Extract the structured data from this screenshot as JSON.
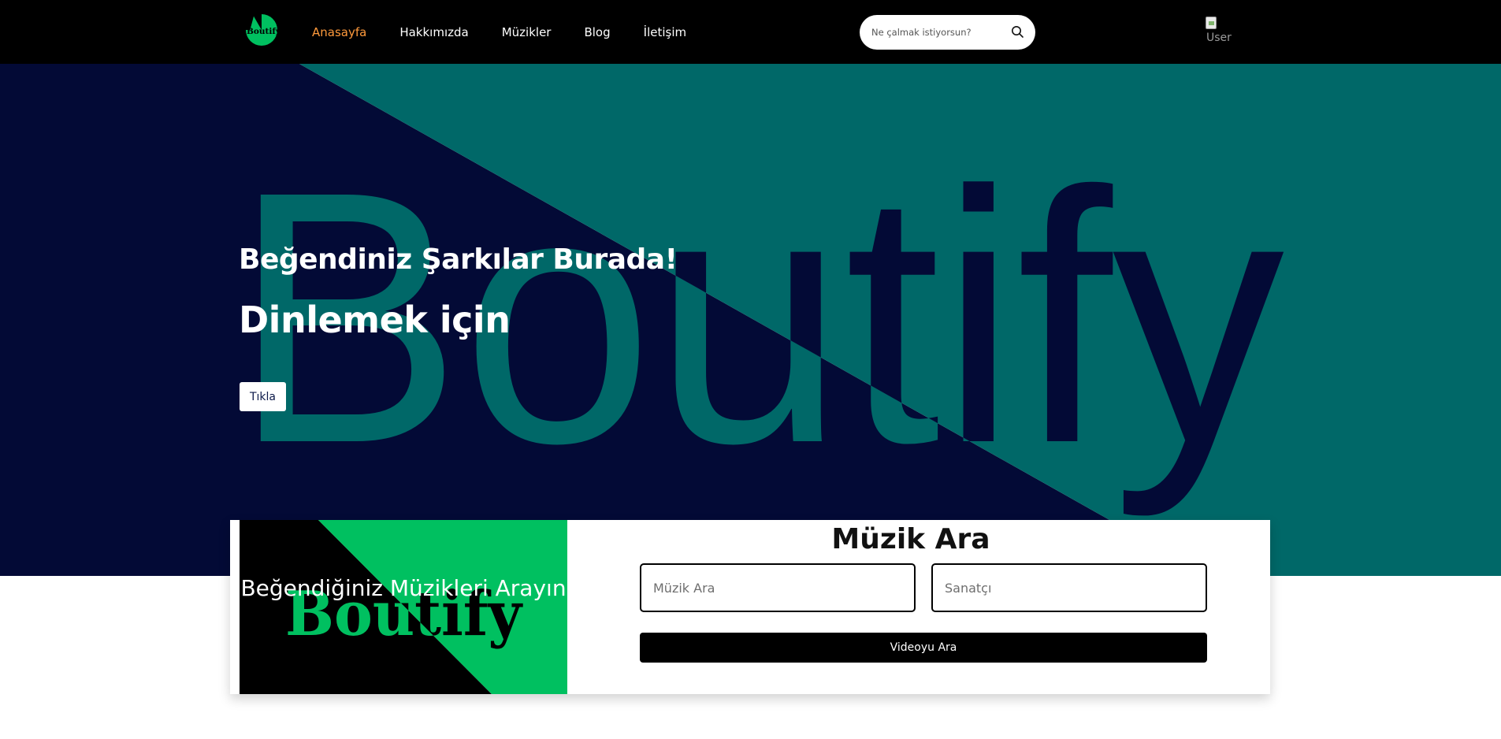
{
  "nav": {
    "logo_text": "Boutify",
    "links": [
      "Anasayfa",
      "Hakkımızda",
      "Müzikler",
      "Blog",
      "İletişim"
    ],
    "active_index": 0,
    "search_placeholder": "Ne çalmak istiyorsun?",
    "user_image_alt": "User"
  },
  "hero": {
    "title": "Beğendiniz Şarkılar Burada!",
    "subtitle": "Dinlemek için",
    "button_label": "Tıkla",
    "background_word": "Boutify"
  },
  "music_search": {
    "banner_word": "Boutify",
    "banner_caption": "Beğendiğiniz Müzikleri Arayın",
    "title": "Müzik Ara",
    "music_placeholder": "Müzik Ara",
    "artist_placeholder": "Sanatçı",
    "button_label": "Videoyu Ara"
  },
  "colors": {
    "nav_bg": "#000000",
    "nav_active": "#ff9a3c",
    "hero_navy": "#030a36",
    "hero_teal": "#006868",
    "accent_green": "#00c060",
    "button_text": "#0d1a4a"
  }
}
